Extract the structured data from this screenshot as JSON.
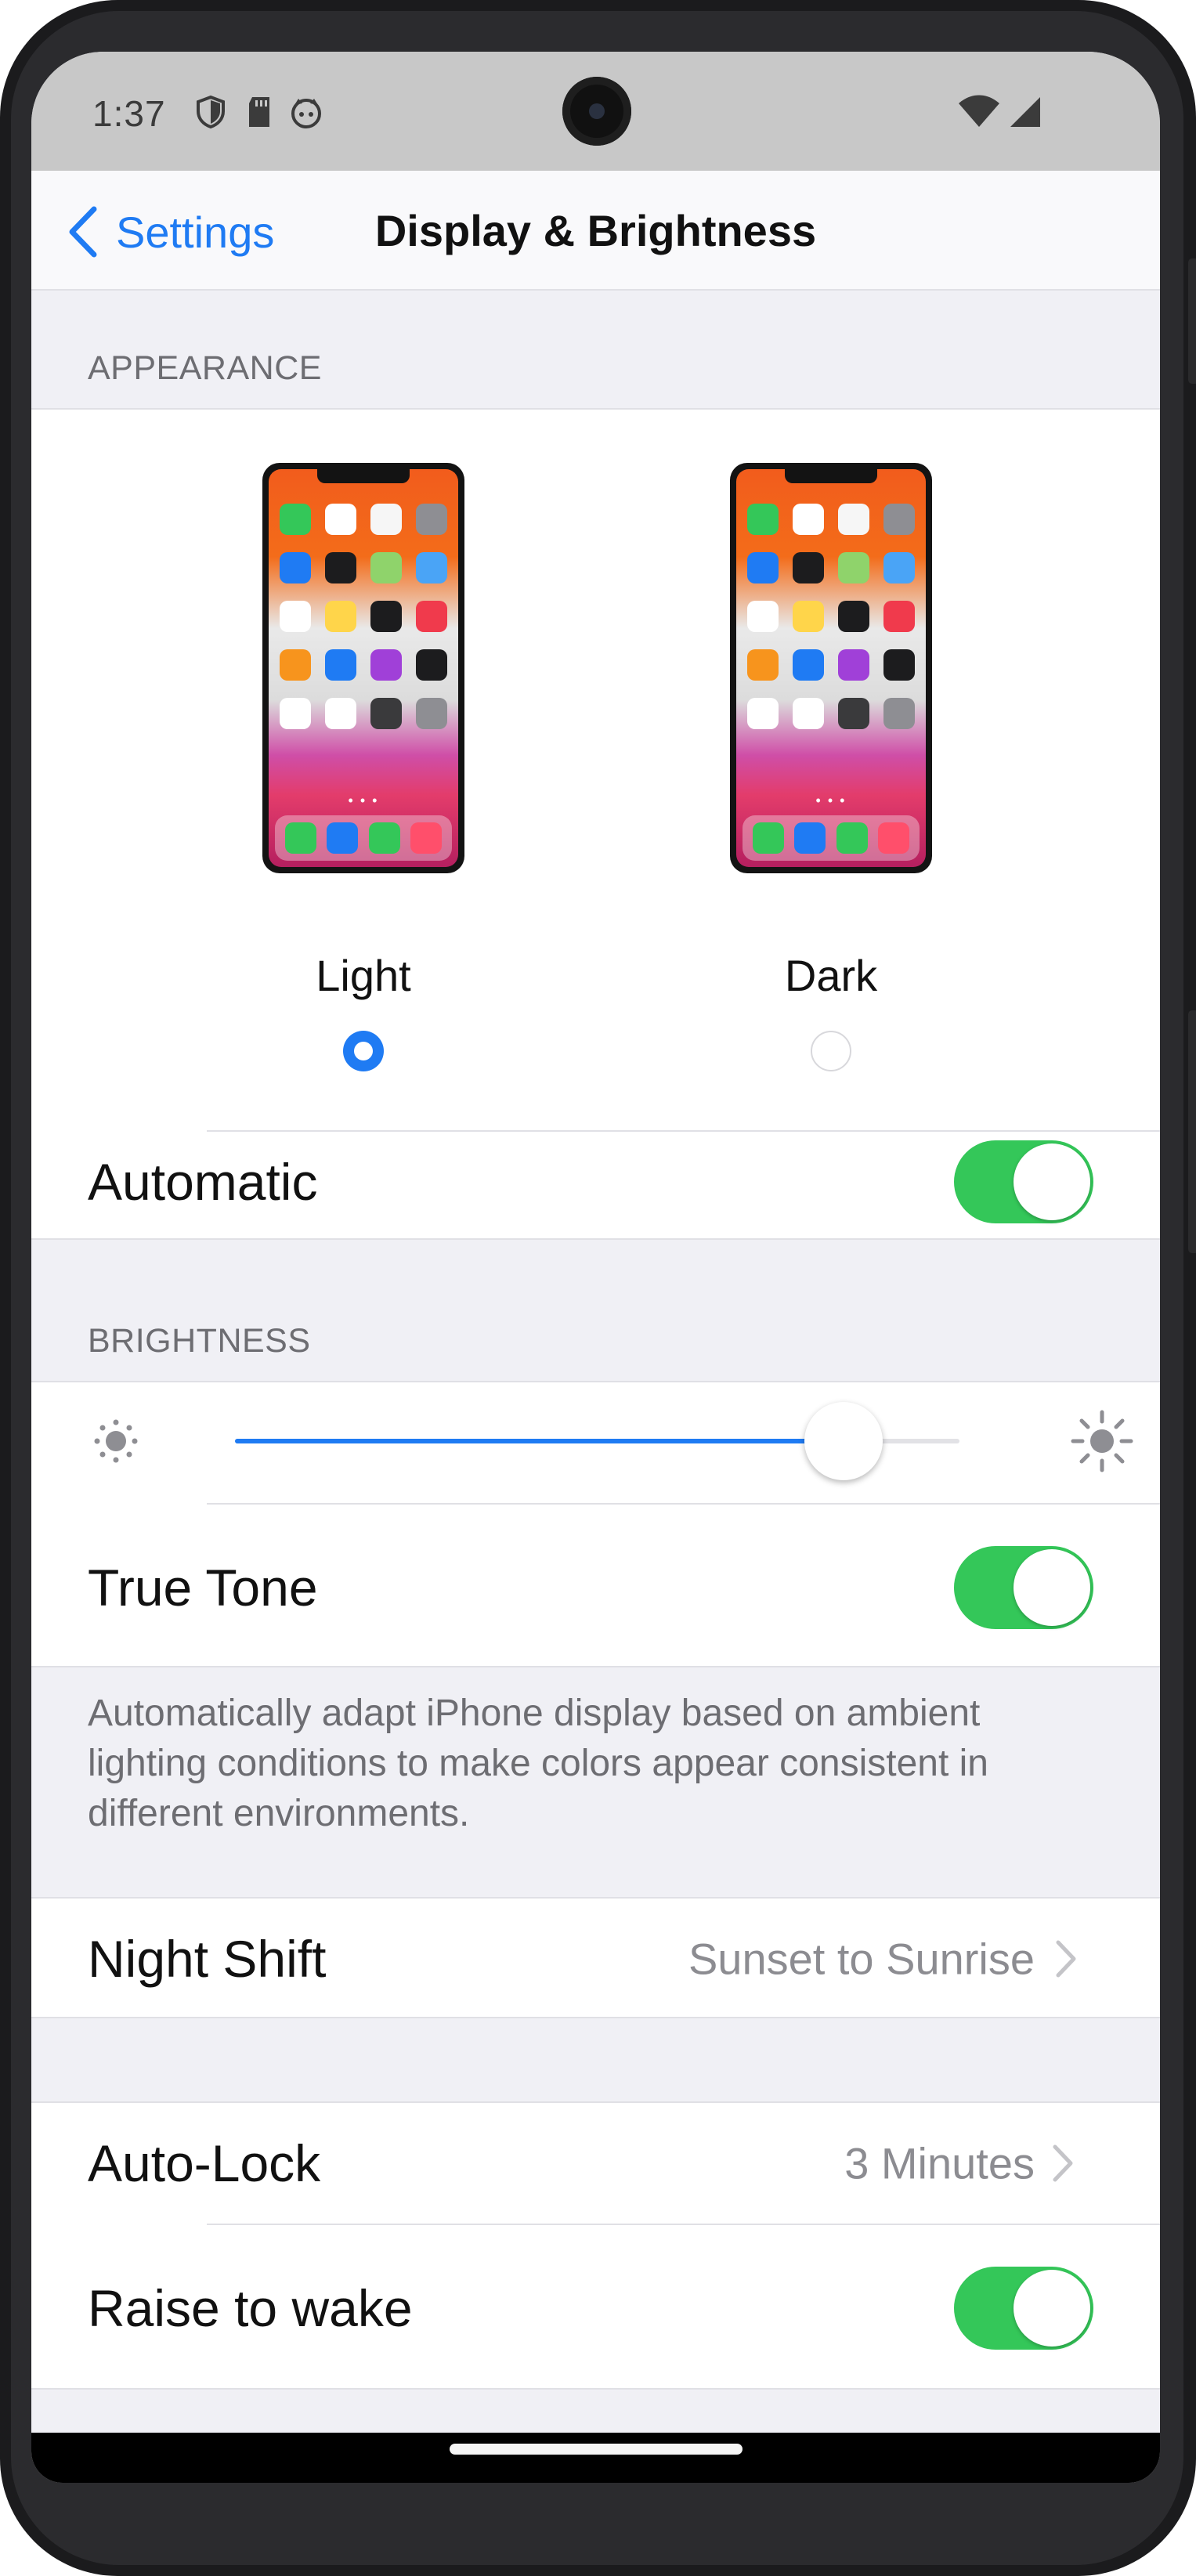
{
  "status_bar": {
    "time": "1:37",
    "icons": [
      "shield-icon",
      "sd-card-icon",
      "android-face-icon",
      "wifi-icon",
      "cellular-signal-icon"
    ]
  },
  "nav": {
    "back_label": "Settings",
    "title": "Display & Brightness"
  },
  "appearance": {
    "header": "APPEARANCE",
    "options": [
      {
        "label": "Light",
        "selected": true
      },
      {
        "label": "Dark",
        "selected": false
      }
    ],
    "automatic": {
      "label": "Automatic",
      "on": true
    }
  },
  "brightness": {
    "header": "BRIGHTNESS",
    "level": 0.84,
    "icons": [
      "brightness-low-icon",
      "brightness-high-icon"
    ],
    "true_tone": {
      "label": "True Tone",
      "on": true
    },
    "footnote": "Automatically adapt iPhone display based on ambient lighting conditions to make colors appear consistent in different environments."
  },
  "night_shift": {
    "label": "Night Shift",
    "value": "Sunset to Sunrise"
  },
  "auto_lock": {
    "label": "Auto-Lock",
    "value": "3 Minutes"
  },
  "raise_to_wake": {
    "label": "Raise to wake",
    "on": true
  },
  "colors": {
    "accent": "#1f7bf3",
    "toggle_on": "#34c759",
    "status_bar": "#c8c8c8",
    "grouped_background": "#f0f0f5"
  }
}
